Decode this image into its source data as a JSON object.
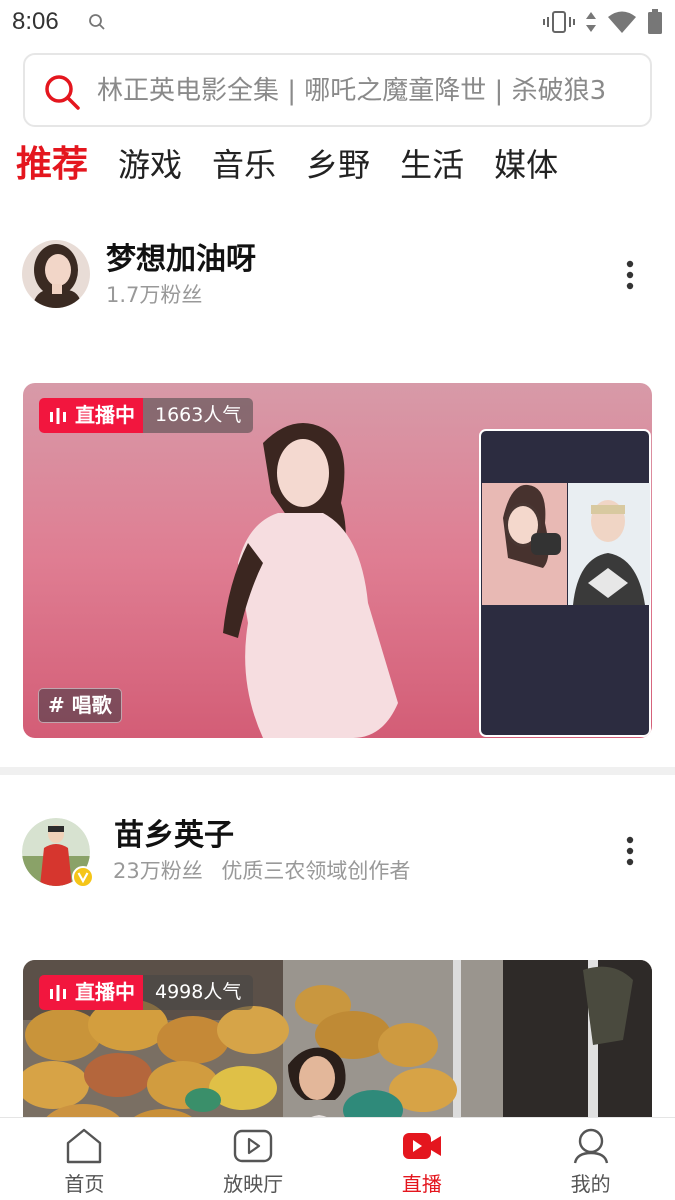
{
  "status_bar": {
    "time": "8:06",
    "icons": [
      "search-icon",
      "vibrate-icon",
      "data-arrows-icon",
      "wifi-icon",
      "battery-icon"
    ]
  },
  "search": {
    "placeholder": "林正英电影全集 | 哪吒之魔童降世 | 杀破狼3",
    "icon": "search-icon",
    "accent": "#e4161e"
  },
  "tabs": [
    {
      "label": "推荐",
      "active": true
    },
    {
      "label": "游戏",
      "active": false
    },
    {
      "label": "音乐",
      "active": false
    },
    {
      "label": "乡野",
      "active": false
    },
    {
      "label": "生活",
      "active": false
    },
    {
      "label": "媒体",
      "active": false
    }
  ],
  "feed": [
    {
      "user": {
        "name": "梦想加油呀",
        "followers": "1.7万粉丝",
        "verified": false
      },
      "live_label": "直播中",
      "popularity": "1663人气",
      "hashtag": "# 唱歌",
      "has_pk_overlay": true
    },
    {
      "user": {
        "name": "苗乡英子",
        "followers": "23万粉丝",
        "description": "优质三农领域创作者",
        "verified": true
      },
      "live_label": "直播中",
      "popularity": "4998人气"
    }
  ],
  "bottom_nav": [
    {
      "label": "首页",
      "icon": "home-icon",
      "active": false
    },
    {
      "label": "放映厅",
      "icon": "screening-room-icon",
      "active": false
    },
    {
      "label": "直播",
      "icon": "live-camera-icon",
      "active": true
    },
    {
      "label": "我的",
      "icon": "profile-icon",
      "active": false
    }
  ],
  "colors": {
    "accent": "#e4161e",
    "live_badge": "#f2163e",
    "verified_badge": "#f5c518"
  }
}
